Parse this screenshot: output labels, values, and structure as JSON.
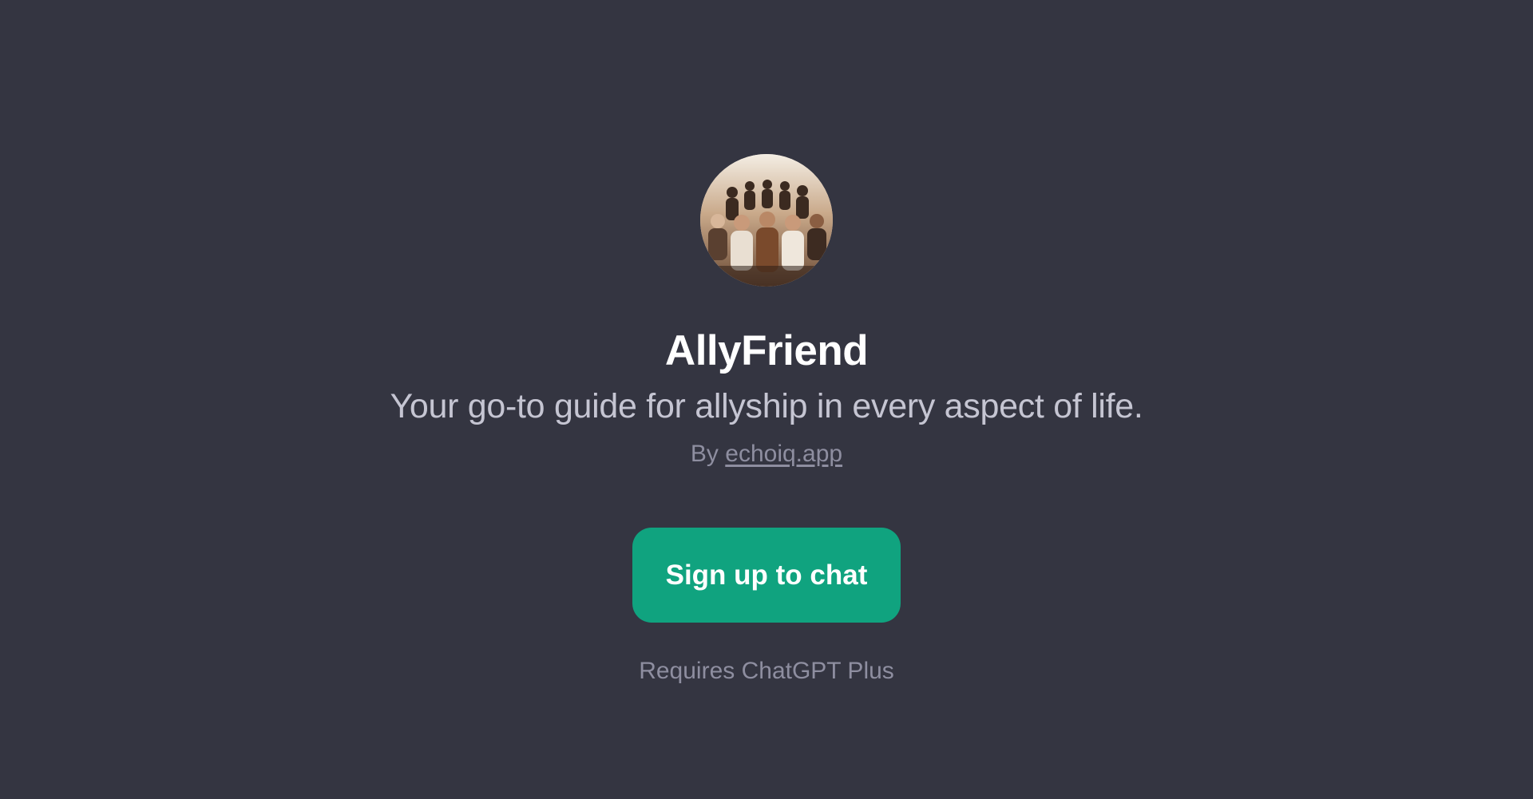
{
  "gpt": {
    "title": "AllyFriend",
    "description": "Your go-to guide for allyship in every aspect of life.",
    "by_prefix": "By",
    "author_link": "echoiq.app",
    "avatar_icon": "group-photo-avatar"
  },
  "cta": {
    "label": "Sign up to chat"
  },
  "footer": {
    "requires": "Requires ChatGPT Plus"
  },
  "colors": {
    "background": "#343541",
    "accent": "#10a37f",
    "title": "#ffffff",
    "subtitle": "#c5c5d2",
    "muted": "#8e8ea0"
  }
}
